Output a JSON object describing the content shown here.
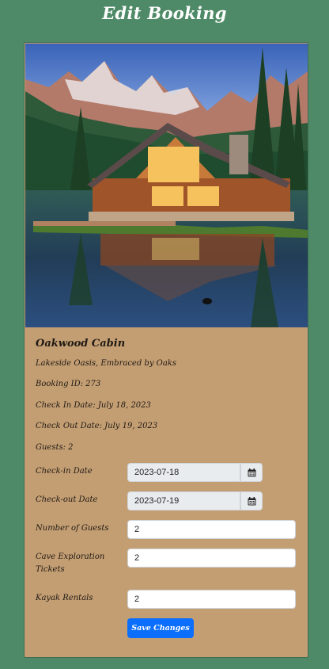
{
  "page": {
    "title": "Edit Booking"
  },
  "cabin": {
    "name": "Oakwood Cabin",
    "tagline": "Lakeside Oasis, Embraced by Oaks",
    "booking_id": "Booking ID: 273",
    "check_in": "Check In Date: July 18, 2023",
    "check_out": "Check Out Date: July 19, 2023",
    "guests": "Guests: 2"
  },
  "form": {
    "checkin_label": "Check-in Date",
    "checkin_value": "2023-07-18",
    "checkout_label": "Check-out Date",
    "checkout_value": "2023-07-19",
    "guests_label": "Number of Guests",
    "guests_value": "2",
    "cave_label": "Cave Exploration Tickets",
    "cave_value": "2",
    "kayak_label": "Kayak Rentals",
    "kayak_value": "2",
    "save_label": "Save Changes"
  },
  "icons": {
    "calendar": "calendar-icon"
  },
  "colors": {
    "background": "#4e8a67",
    "card": "#c49e73",
    "primary_button": "#0b6efd"
  }
}
